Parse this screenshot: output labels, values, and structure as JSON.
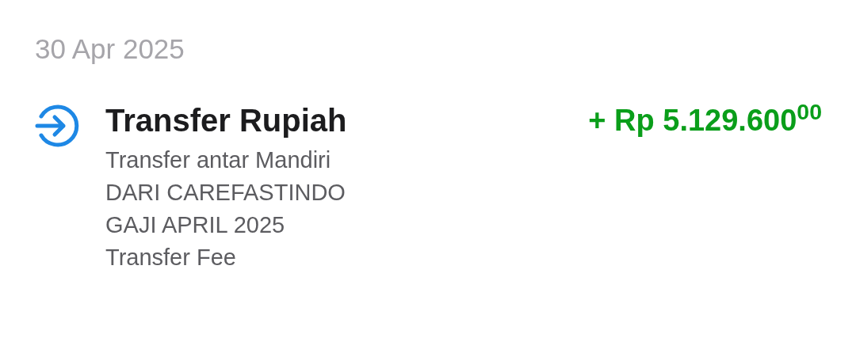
{
  "date": "30 Apr 2025",
  "transaction": {
    "kind": "incoming",
    "title": "Transfer Rupiah",
    "amount": "+ Rp 5.129.600$^{00}$",
    "details": [
      "Transfer antar Mandiri",
      "DARI CAREFASTINDO",
      "GAJI APRIL 2025",
      "Transfer Fee"
    ]
  }
}
